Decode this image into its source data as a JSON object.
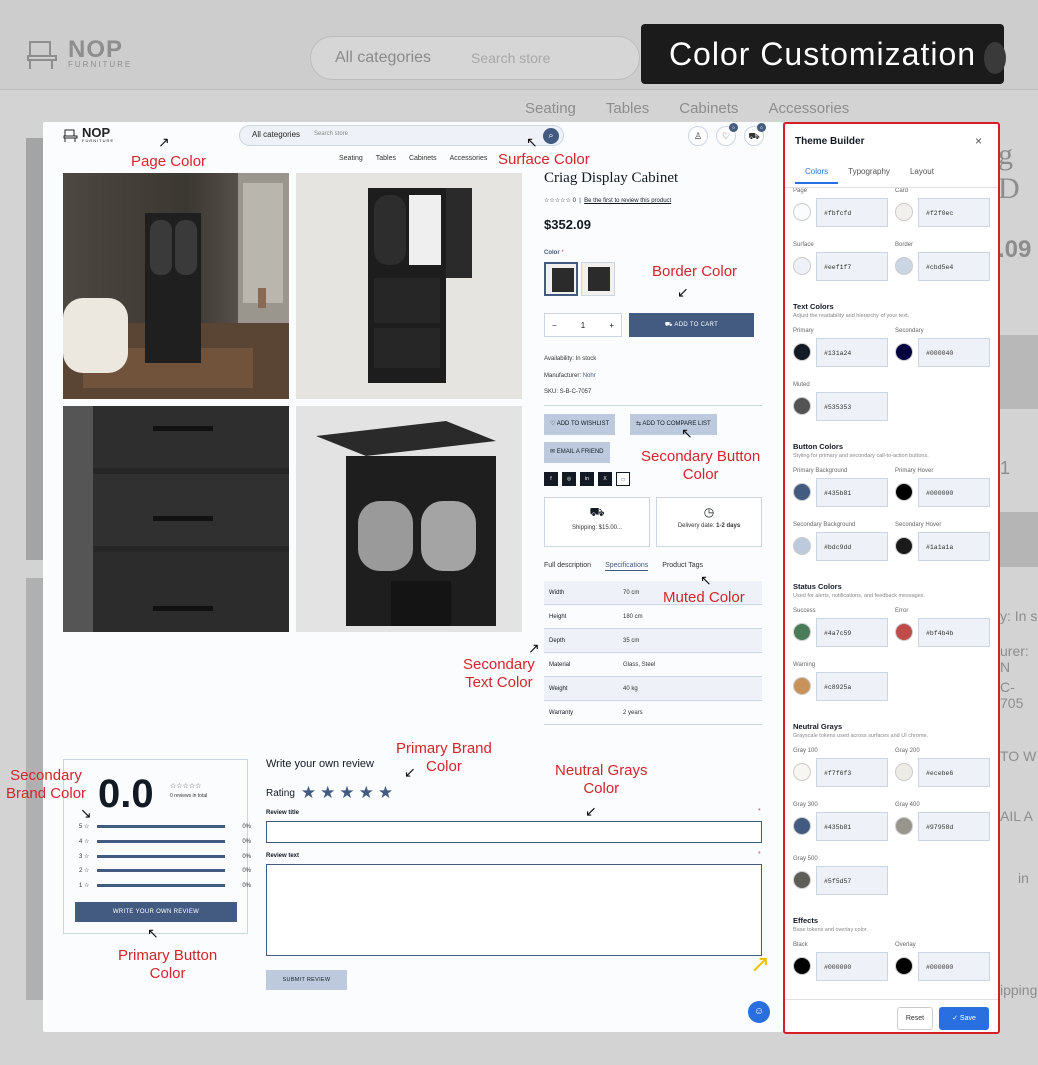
{
  "banner": {
    "title": "Color Customization"
  },
  "background": {
    "brand": "NOP",
    "brand_sub": "FURNITURE",
    "categories": "All categories",
    "search_placeholder": "Search store",
    "nav": [
      "Seating",
      "Tables",
      "Cabinets",
      "Accessories"
    ],
    "title_fragment": "g D",
    "price_fragment": ".09",
    "frag_stock": "y: In s",
    "frag_manu": "urer: N",
    "frag_sku": "C-705",
    "frag_qty": "1",
    "frag_wish": "TO W",
    "frag_email": "AIL A",
    "frag_in": "in",
    "frag_ship": "ipping"
  },
  "store": {
    "brand": "NOP",
    "brand_sub": "FURNITURE",
    "categories": "All categories",
    "search_placeholder": "Search store",
    "nav": [
      "Seating",
      "Tables",
      "Cabinets",
      "Accessories"
    ],
    "badges": [
      "0",
      "0"
    ],
    "product": {
      "title": "Criag Display Cabinet",
      "stars": "☆☆☆☆☆",
      "review_count": "0",
      "review_link": "Be the first to review this product",
      "price": "$352.09",
      "color_label": "Color",
      "qty": "1",
      "add_to_cart": "ADD TO CART",
      "availability": "Availability: In stock",
      "manufacturer_label": "Manufacturer:",
      "manufacturer": "Nohr",
      "sku": "SKU: S-B-C-7057",
      "wishlist": "ADD TO WISHLIST",
      "compare": "ADD TO COMPARE LIST",
      "email": "EMAIL A FRIEND",
      "social": [
        "f",
        "◎",
        "in",
        "X",
        "□"
      ],
      "shipping": "Shipping: $15.00...",
      "delivery_label": "Delivery date:",
      "delivery": "1-2 days",
      "tabs": [
        "Full description",
        "Specifications",
        "Product Tags"
      ],
      "specs": [
        {
          "k": "Width",
          "v": "70 cm"
        },
        {
          "k": "Height",
          "v": "180 cm"
        },
        {
          "k": "Depth",
          "v": "35 cm"
        },
        {
          "k": "Material",
          "v": "Glass, Steel"
        },
        {
          "k": "Weight",
          "v": "40 kg"
        },
        {
          "k": "Warranty",
          "v": "2 years"
        }
      ]
    },
    "reviews": {
      "score": "0.0",
      "stars": "☆☆☆☆☆",
      "total": "0 reviews in total",
      "rows": [
        {
          "l": "5 ☆",
          "p": "0%"
        },
        {
          "l": "4 ☆",
          "p": "0%"
        },
        {
          "l": "3 ☆",
          "p": "0%"
        },
        {
          "l": "2 ☆",
          "p": "0%"
        },
        {
          "l": "1 ☆",
          "p": "0%"
        }
      ],
      "write_btn": "WRITE YOUR OWN REVIEW",
      "write_title": "Write your own review",
      "rating_label": "Rating",
      "rating_stars": "★★★★★",
      "title_label": "Review title",
      "text_label": "Review text",
      "required": "*",
      "submit": "SUBMIT REVIEW"
    }
  },
  "annotations": {
    "page": "Page Color",
    "surface": "Surface Color",
    "border": "Border Color",
    "secondary_button_1": "Secondary Button",
    "secondary_button_2": "Color",
    "muted": "Muted Color",
    "secondary_text_1": "Secondary",
    "secondary_text_2": "Text Color",
    "primary_brand_1": "Primary Brand",
    "primary_brand_2": "Color",
    "neutral_1": "Neutral Grays",
    "neutral_2": "Color",
    "secondary_brand_1": "Secondary",
    "secondary_brand_2": "Brand Color",
    "primary_button_1": "Primary Button",
    "primary_button_2": "Color"
  },
  "theme_builder": {
    "title": "Theme Builder",
    "close": "×",
    "tabs": [
      "Colors",
      "Typography",
      "Layout"
    ],
    "groups": {
      "text_title": "Text Colors",
      "text_desc": "Adjust the readability and hierarchy of your text.",
      "button_title": "Button Colors",
      "button_desc": "Styling for primary and secondary call-to-action buttons.",
      "status_title": "Status Colors",
      "status_desc": "Used for alerts, notifications, and feedback messages.",
      "neutral_title": "Neutral Grays",
      "neutral_desc": "Grayscale tokens used across surfaces and UI chrome.",
      "effects_title": "Effects",
      "effects_desc": "Base tokens and overlay color."
    },
    "tokens": {
      "page": {
        "label": "Page",
        "hex": "#fbfcfd"
      },
      "card": {
        "label": "Card",
        "hex": "#f2f0ec"
      },
      "surface": {
        "label": "Surface",
        "hex": "#eef1f7"
      },
      "border": {
        "label": "Border",
        "hex": "#cbd5e4"
      },
      "primary": {
        "label": "Primary",
        "hex": "#131a24"
      },
      "secondary": {
        "label": "Secondary",
        "hex": "#000040"
      },
      "muted": {
        "label": "Muted",
        "hex": "#535353"
      },
      "primary_bg": {
        "label": "Primary Background",
        "hex": "#435b81"
      },
      "primary_hover": {
        "label": "Primary Hover",
        "hex": "#000000"
      },
      "secondary_bg": {
        "label": "Secondary Background",
        "hex": "#bdc9dd"
      },
      "secondary_hover": {
        "label": "Secondary Hover",
        "hex": "#1a1a1a"
      },
      "success": {
        "label": "Success",
        "hex": "#4a7c59"
      },
      "error": {
        "label": "Error",
        "hex": "#bf4b4b"
      },
      "warning": {
        "label": "Warning",
        "hex": "#c8925a"
      },
      "gray100": {
        "label": "Gray 100",
        "hex": "#f7f6f3"
      },
      "gray200": {
        "label": "Gray 200",
        "hex": "#ecebe6"
      },
      "gray300": {
        "label": "Gray 300",
        "hex": "#435b81"
      },
      "gray400": {
        "label": "Gray 400",
        "hex": "#97958d"
      },
      "gray500": {
        "label": "Gray 500",
        "hex": "#5f5d57"
      },
      "black": {
        "label": "Black",
        "hex": "#000000"
      },
      "overlay": {
        "label": "Overlay",
        "hex": "#000000"
      }
    },
    "reset": "Reset",
    "save": "✓ Save"
  }
}
